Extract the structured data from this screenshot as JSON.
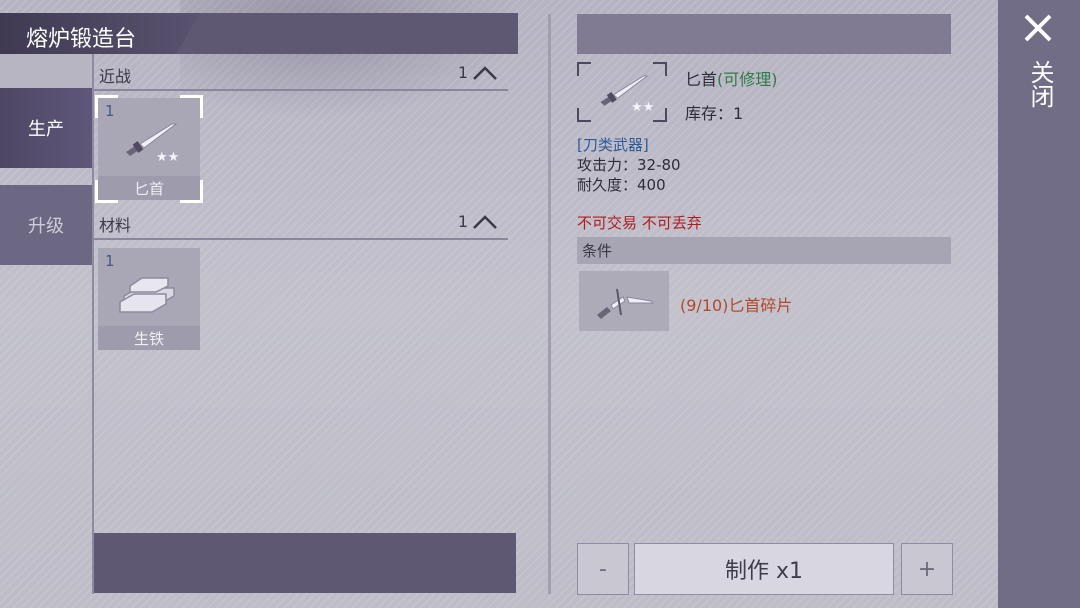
{
  "window": {
    "title": "熔炉锻造台"
  },
  "tabs": [
    {
      "label": "生产",
      "active": true
    },
    {
      "label": "升级",
      "active": false
    }
  ],
  "sections": [
    {
      "label": "近战",
      "count": "1",
      "items": [
        {
          "num": "1",
          "name": "匕首",
          "stars": "★★",
          "selected": true
        }
      ]
    },
    {
      "label": "材料",
      "count": "1",
      "items": [
        {
          "num": "1",
          "name": "生铁",
          "selected": false
        }
      ]
    }
  ],
  "detail": {
    "name": "匕首",
    "repairable": "(可修理)",
    "stock": "库存：1",
    "stars": "★★",
    "category": "[刀类武器]",
    "attack": "攻击力：32-80",
    "durability": "耐久度：400",
    "warning": "不可交易 不可丢弃",
    "condition_header": "条件",
    "condition_item": "(9/10)匕首碎片"
  },
  "actions": {
    "minus": "-",
    "make": "制作 x1",
    "plus": "+"
  },
  "close": {
    "label": "关闭"
  },
  "colors": {
    "accent": "#5e5873",
    "repairable": "#2e7d46",
    "category": "#2f5b97",
    "warning": "#b01d1d",
    "condition": "#b24a2a"
  }
}
